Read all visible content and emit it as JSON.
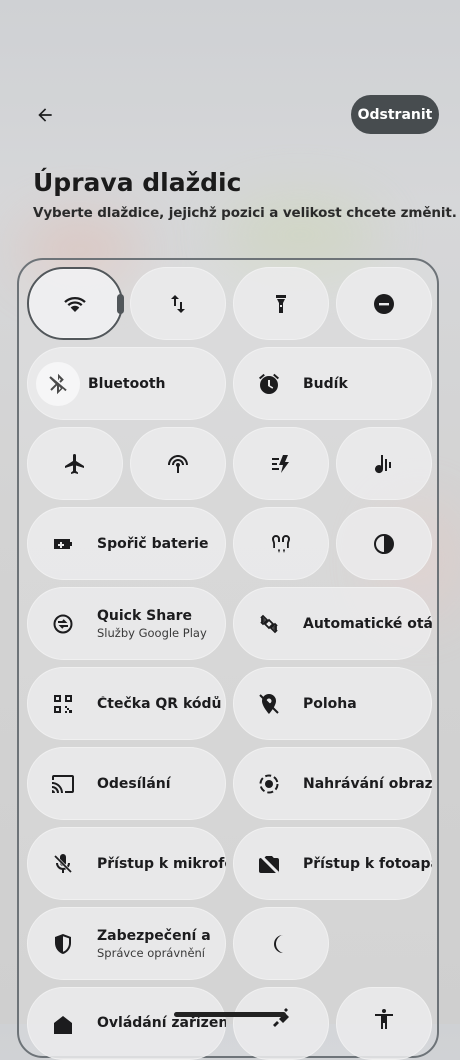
{
  "header": {
    "back_icon": "arrow-back-icon",
    "delete_label": "Odstranit"
  },
  "title": "Úprava dlaždic",
  "subtitle": "Vyberte dlaždice, jejichž pozici a velikost chcete změnit.",
  "tiles": [
    {
      "id": "wifi",
      "icon": "wifi-icon",
      "selected": true
    },
    {
      "id": "data",
      "icon": "mobile-data-icon"
    },
    {
      "id": "flashlight",
      "icon": "flashlight-icon"
    },
    {
      "id": "dnd",
      "icon": "do-not-disturb-icon"
    },
    {
      "id": "bluetooth",
      "icon": "bluetooth-off-icon",
      "label": "Bluetooth"
    },
    {
      "id": "alarm",
      "icon": "alarm-icon",
      "label": "Budík"
    },
    {
      "id": "airplane",
      "icon": "airplane-icon"
    },
    {
      "id": "hotspot",
      "icon": "hotspot-icon"
    },
    {
      "id": "extra-dim",
      "icon": "bolt-icon"
    },
    {
      "id": "live-caption",
      "icon": "live-caption-icon"
    },
    {
      "id": "battery-saver",
      "icon": "battery-saver-icon",
      "label": "Spořič baterie"
    },
    {
      "id": "hearing",
      "icon": "hearing-icon"
    },
    {
      "id": "contrast",
      "icon": "contrast-icon"
    },
    {
      "id": "quick-share",
      "icon": "quick-share-icon",
      "label": "Quick Share",
      "sub": "Služby Google Play"
    },
    {
      "id": "auto-rotate",
      "icon": "auto-rotate-icon",
      "label": "Automatické otáčení"
    },
    {
      "id": "qr-scanner",
      "icon": "qr-code-icon",
      "label": "Čtečka QR kódů"
    },
    {
      "id": "location",
      "icon": "location-off-icon",
      "label": "Poloha"
    },
    {
      "id": "cast",
      "icon": "cast-icon",
      "label": "Odesílání"
    },
    {
      "id": "screen-record",
      "icon": "screen-record-icon",
      "label": "Nahrávání obrazovky"
    },
    {
      "id": "mic-access",
      "icon": "mic-off-icon",
      "label": "Přístup k mikrofonu"
    },
    {
      "id": "camera-access",
      "icon": "camera-off-icon",
      "label": "Přístup k fotoaparátu"
    },
    {
      "id": "security",
      "icon": "shield-icon",
      "label": "Zabezpečení a",
      "sub": "Správce oprávnění"
    },
    {
      "id": "dark-theme",
      "icon": "moon-icon"
    },
    {
      "id": "home",
      "icon": "home-icon",
      "label": "Ovládání zařízení"
    },
    {
      "id": "satellite",
      "icon": "satellite-icon"
    },
    {
      "id": "accessibility",
      "icon": "accessibility-icon"
    }
  ]
}
